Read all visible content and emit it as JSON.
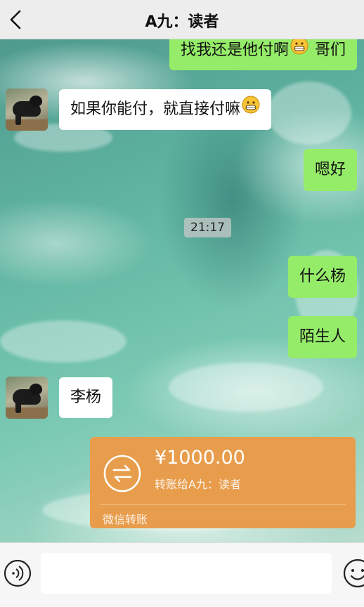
{
  "header": {
    "title": "A九：读者",
    "back_icon": "chevron-left-icon"
  },
  "messages": {
    "m1": {
      "text": "找我还是他付啊",
      "emoji": "grinning-face-icon",
      "trailing": " 哥们",
      "side": "right"
    },
    "m2": {
      "text": "如果你能付，就直接付嘛",
      "emoji": "grinning-face-icon",
      "side": "left"
    },
    "m3": {
      "text": "嗯好",
      "side": "right"
    },
    "time": "21:17",
    "m4": {
      "text": "什么杨",
      "side": "right"
    },
    "m5": {
      "text": "陌生人",
      "side": "right"
    },
    "m6": {
      "text": "李杨",
      "side": "left"
    }
  },
  "transfer": {
    "amount": "¥1000.00",
    "description": "转账给A九：读者",
    "footer": "微信转账",
    "icon": "transfer-arrows-icon",
    "color": "#e89d4c"
  },
  "input_bar": {
    "voice_icon": "voice-icon",
    "emoji_icon": "emoji-icon",
    "value": ""
  },
  "colors": {
    "sent_bubble": "#95ec69",
    "received_bubble": "#ffffff",
    "header_bg": "#ededed"
  }
}
